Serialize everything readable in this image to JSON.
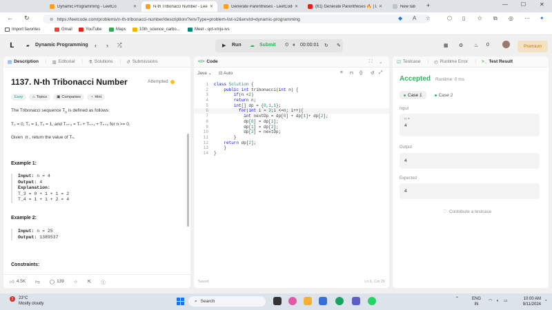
{
  "browser": {
    "tabs": [
      {
        "title": "Dynamic Programming - LeetCo",
        "active": false
      },
      {
        "title": "N-th Tribonacci Number - LeetCo",
        "active": true
      },
      {
        "title": "Generate Parentheses - LeetCode",
        "active": false
      },
      {
        "title": "(61) Generate Parentheses 🔥 | Lo",
        "active": false
      },
      {
        "title": "New tab",
        "active": false
      }
    ],
    "url": "https://leetcode.com/problems/n-th-tribonacci-number/description/?envType=problem-list-v2&envId=dynamic-programming",
    "bookmarks": [
      "Import favorites",
      "Gmail",
      "YouTube",
      "Maps",
      "10th_science_carbo...",
      "Meet - qct-xmju-ivs"
    ]
  },
  "lc_header": {
    "list_title": "Dynamic Programming",
    "run_label": "Run",
    "submit_label": "Submit",
    "timer": "00:00:01",
    "coins": "0",
    "premium_label": "Premium"
  },
  "left": {
    "tabs": [
      "Description",
      "Editorial",
      "Solutions",
      "Submissions"
    ],
    "title": "1137. N-th Tribonacci Number",
    "status": "Attempted",
    "chips": [
      "Easy",
      "Topics",
      "Companies",
      "Hint"
    ],
    "intro_prefix": "The Tribonacci sequence T",
    "intro_sub": "n",
    "intro_suffix": " is defined as follows:",
    "formula": "T₀ = 0, T₁ = 1, T₂ = 1, and Tₙ₊₃ = Tₙ + Tₙ₊₁ + Tₙ₊₂ for n >= 0.",
    "given_prefix": "Given ",
    "given_var": "n",
    "given_suffix": ", return the value of Tₙ.",
    "example1_heading": "Example 1:",
    "example1": {
      "input_label": "Input:",
      "input_value": " n = 4",
      "output_label": "Output:",
      "output_value": " 4",
      "explanation_label": "Explanation:",
      "explanation_lines": [
        "T_3 = 0 + 1 + 1 = 2",
        "T_4 = 1 + 1 + 2 = 4"
      ]
    },
    "example2_heading": "Example 2:",
    "example2": {
      "input_label": "Input:",
      "input_value": " n = 25",
      "output_label": "Output:",
      "output_value": " 1389537"
    },
    "constraints_heading": "Constraints:",
    "likes": "4.5K",
    "comments": "139"
  },
  "code": {
    "tab_label": "Code",
    "language": "Java",
    "mode": "Auto",
    "lines": [
      "class Solution {",
      "    public int tribonacci(int n) {",
      "        if(n <2)",
      "        return n;",
      "        int[] dp = {0,1,1};",
      "          for(int i = 3;i <=n; i++){",
      "            int nextDp = dp[0] + dp[1]+ dp[2];",
      "            dp[0] = dp[1];",
      "            dp[1] = dp[2];",
      "            dp[2] = nextDp;",
      "        }",
      "    return dp[2];",
      "    }",
      "}"
    ],
    "saved": "Saved",
    "cursor": "Ln 6, Col 26"
  },
  "result": {
    "tabs": [
      "Testcase",
      "Runtime Error",
      "Test Result"
    ],
    "status": "Accepted",
    "runtime": "Runtime: 0 ms",
    "cases": [
      "Case 1",
      "Case 2"
    ],
    "input_label": "Input",
    "input_var": "n =",
    "input_value": "4",
    "output_label": "Output",
    "output_value": "4",
    "expected_label": "Expected",
    "expected_value": "4",
    "contribute": "Contribute a testcase"
  },
  "taskbar": {
    "temp": "23°C",
    "weather": "Mostly cloudy",
    "weather_badge": "1",
    "search": "Search",
    "lang1": "ENG",
    "lang2": "IN",
    "time": "10:00 AM",
    "date": "9/11/2024"
  },
  "colors": {
    "accent": "#ffa116",
    "accepted": "#2db55d",
    "easy": "#00af9b",
    "premium": "#c47b08"
  }
}
